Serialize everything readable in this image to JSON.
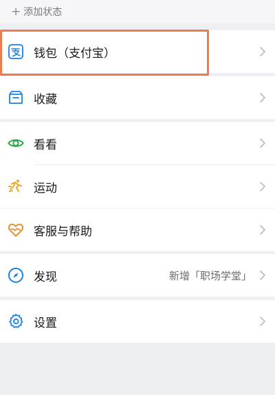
{
  "status": {
    "add_label": "添加状态"
  },
  "menu": {
    "wallet": {
      "label": "钱包（支付宝）"
    },
    "favorites": {
      "label": "收藏"
    },
    "look": {
      "label": "看看"
    },
    "sports": {
      "label": "运动"
    },
    "support": {
      "label": "客服与帮助"
    },
    "discover": {
      "label": "发现",
      "subtitle": "新增「职场学堂」"
    },
    "settings": {
      "label": "设置"
    }
  },
  "colors": {
    "background": "#eeeff2",
    "highlight": "#ef7a4f",
    "alipay_blue": "#1a7fe3",
    "look_green": "#27a64a",
    "sports_orange": "#f0a22a",
    "support_orange": "#e9912c",
    "discover_blue": "#1a7fe3",
    "settings_blue": "#1a7fe3"
  }
}
